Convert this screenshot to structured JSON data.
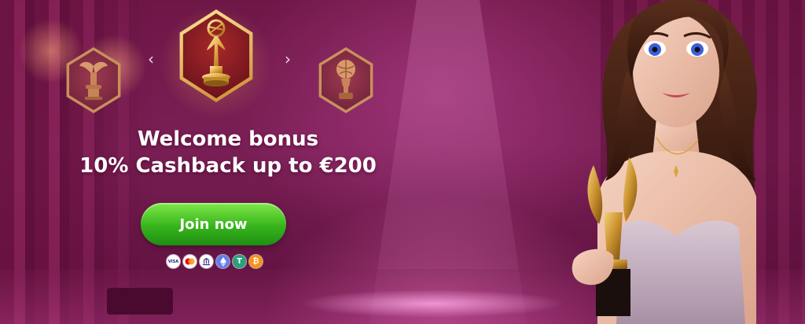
{
  "banner": {
    "headline_line1": "Welcome bonus",
    "headline_line2": "10% Cashback up to €200",
    "cta_label": "Join now"
  },
  "carousel": {
    "prev_arrow": "‹",
    "next_arrow": "›",
    "items": [
      {
        "icon": "winged-trophy-icon",
        "state": "inactive"
      },
      {
        "icon": "award-statuette-icon",
        "state": "active"
      },
      {
        "icon": "globe-trophy-icon",
        "state": "inactive"
      }
    ]
  },
  "payment_methods": [
    {
      "icon": "visa-icon",
      "label": "VISA"
    },
    {
      "icon": "mastercard-icon"
    },
    {
      "icon": "bank-icon"
    },
    {
      "icon": "ethereum-icon"
    },
    {
      "icon": "tether-icon",
      "label": "T"
    },
    {
      "icon": "bitcoin-icon",
      "label": "₿"
    }
  ],
  "colors": {
    "background": "#7a1f55",
    "cta_green": "#37b51c",
    "gold": "#d9a441",
    "text": "#ffffff"
  }
}
